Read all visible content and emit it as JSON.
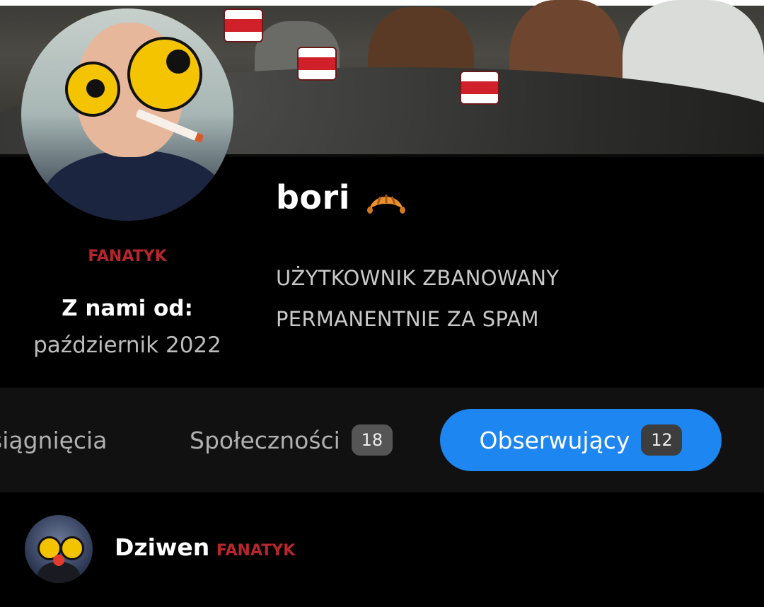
{
  "profile": {
    "username": "bori",
    "rank": "FANATYK",
    "member_since_label": "Z nami od:",
    "member_since_value": "październik 2022",
    "bio_line1": "UŻYTKOWNIK ZBANOWANY",
    "bio_line2": "PERMANENTNIE ZA SPAM"
  },
  "tabs": [
    {
      "label": "Osiągnięcia",
      "visible_label": "siągnięcia"
    },
    {
      "label": "Społeczności",
      "count": "18"
    },
    {
      "label": "Obserwujący",
      "count": "12",
      "active": true
    }
  ],
  "followers": [
    {
      "name": "Dziwen",
      "rank": "FANATYK"
    }
  ],
  "colors": {
    "accent": "#1e86f0",
    "rank": "#b8262d",
    "background": "#000000",
    "tabs_background": "#111111"
  }
}
